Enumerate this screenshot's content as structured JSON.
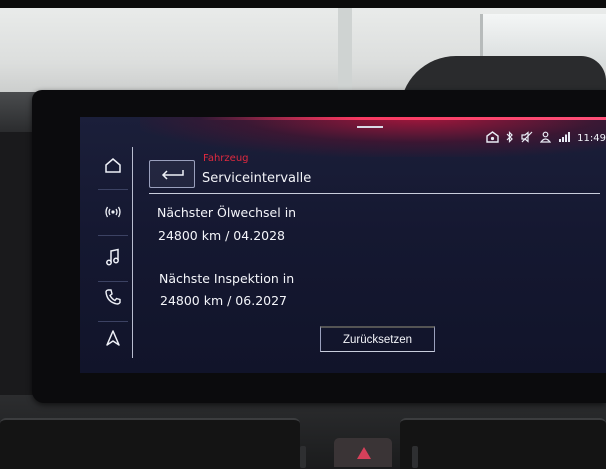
{
  "header": {
    "breadcrumb": "Fahrzeug",
    "title": "Serviceintervalle"
  },
  "status_bar": {
    "time": "11:49",
    "icons": [
      "connected-car-icon",
      "bluetooth-icon",
      "mute-icon",
      "user-icon",
      "signal-icon"
    ]
  },
  "sidebar": {
    "items": [
      {
        "icon": "home-icon"
      },
      {
        "icon": "radio-icon"
      },
      {
        "icon": "music-note-icon"
      },
      {
        "icon": "phone-icon"
      },
      {
        "icon": "navigation-icon"
      }
    ]
  },
  "service": {
    "oil_label": "Nächster Ölwechsel in",
    "oil_value": "24800 km / 04.2028",
    "inspection_label": "Nächste Inspektion in",
    "inspection_value": "24800 km / 06.2027"
  },
  "actions": {
    "reset_label": "Zurücksetzen"
  },
  "colors": {
    "accent_red": "#e0293f",
    "screen_bg": "#151831",
    "text": "#f4f5fa"
  }
}
